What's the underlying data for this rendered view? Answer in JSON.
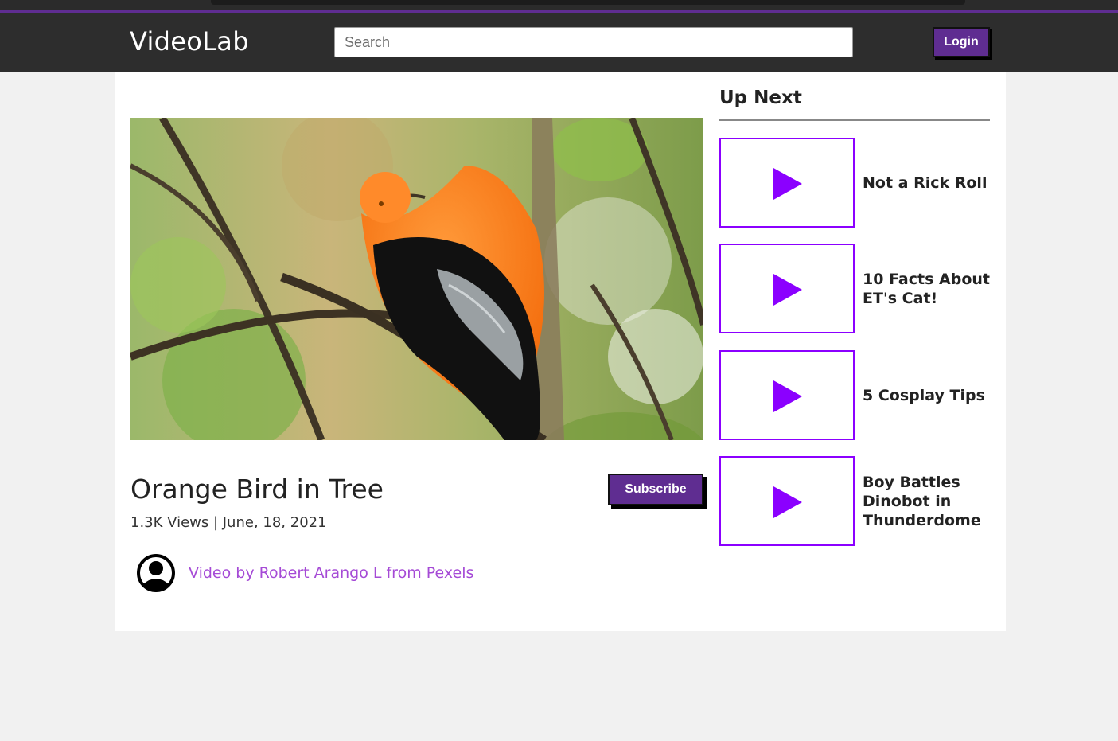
{
  "header": {
    "logo": "VideoLab",
    "search_placeholder": "Search",
    "login_label": "Login"
  },
  "video": {
    "thumbnail_alt": "orange bird on branch",
    "title": "Orange Bird in Tree",
    "meta": "1.3K Views | June, 18, 2021",
    "subscribe_label": "Subscribe",
    "credit": "Video by Robert Arango L from Pexels"
  },
  "up_next": {
    "title": "Up Next",
    "items": [
      {
        "label": "Not a Rick Roll"
      },
      {
        "label": "10 Facts About ET's Cat!"
      },
      {
        "label": "5 Cosplay Tips"
      },
      {
        "label": "Boy Battles Dinobot in Thunderdome"
      }
    ]
  },
  "colors": {
    "accent": "#5f2d91",
    "play": "#8b00ff",
    "link": "#a54ad6",
    "header_bg": "#2d2d2d"
  }
}
